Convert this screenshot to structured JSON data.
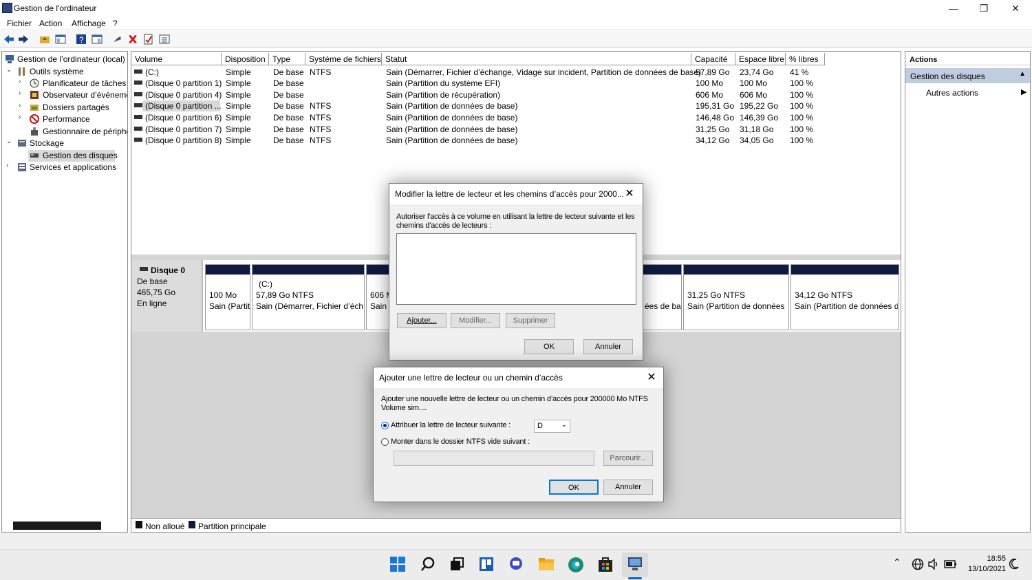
{
  "window": {
    "title": "Gestion de l'ordinateur",
    "minimize": "—",
    "maximize": "❐",
    "close": "✕"
  },
  "menu": [
    "Fichier",
    "Action",
    "Affichage",
    "?"
  ],
  "tree": {
    "root": "Gestion de l’ordinateur (local)",
    "outils": "Outils système",
    "planificateur": "Planificateur de tâches",
    "observateur": "Observateur d’événemen",
    "dossiers": "Dossiers partagés",
    "performance": "Performance",
    "gestionnaire": "Gestionnaire de périphé",
    "stockage": "Stockage",
    "gestion_disques": "Gestion des disques",
    "services": "Services et applications"
  },
  "table": {
    "headers": [
      "Volume",
      "Disposition",
      "Type",
      "Système de fichiers",
      "Statut",
      "Capacité",
      "Espace libre",
      "% libres"
    ],
    "rows": [
      [
        "(C:)",
        "Simple",
        "De base",
        "NTFS",
        "Sain (Démarrer, Fichier d’échange, Vidage sur incident, Partition de données de base)",
        "57,89 Go",
        "23,74 Go",
        "41 %"
      ],
      [
        "(Disque 0 partition 1)",
        "Simple",
        "De base",
        "",
        "Sain (Partition du système EFI)",
        "100 Mo",
        "100 Mo",
        "100 %"
      ],
      [
        "(Disque 0 partition 4)",
        "Simple",
        "De base",
        "",
        "Sain (Partition de récupération)",
        "606 Mo",
        "606 Mo",
        "100 %"
      ],
      [
        "(Disque 0 partition ...",
        "Simple",
        "De base",
        "NTFS",
        "Sain (Partition de données de base)",
        "195,31 Go",
        "195,22 Go",
        "100 %"
      ],
      [
        "(Disque 0 partition 6)",
        "Simple",
        "De base",
        "NTFS",
        "Sain (Partition de données de base)",
        "146,48 Go",
        "146,39 Go",
        "100 %"
      ],
      [
        "(Disque 0 partition 7)",
        "Simple",
        "De base",
        "NTFS",
        "Sain (Partition de données de base)",
        "31,25 Go",
        "31,18 Go",
        "100 %"
      ],
      [
        "(Disque 0 partition 8)",
        "Simple",
        "De base",
        "NTFS",
        "Sain (Partition de données de base)",
        "34,12 Go",
        "34,05 Go",
        "100 %"
      ]
    ]
  },
  "disk": {
    "name": "Disque 0",
    "type": "De base",
    "size": "465,75 Go",
    "state": "En ligne",
    "p1_l1": "100 Mo",
    "p1_l2": "Sain (Partiti",
    "p2_l0": "(C:)",
    "p2_l1": "57,89 Go NTFS",
    "p2_l2": "Sain (Démarrer, Fichier d’écha",
    "p3_l1": "606 M",
    "p3_l2": "Sain",
    "p5_l2": "ées de ba",
    "p6_l1": "31,25 Go NTFS",
    "p6_l2": "Sain (Partition de données c",
    "p7_l1": "34,12 Go NTFS",
    "p7_l2": "Sain (Partition de données d"
  },
  "legend": {
    "unalloc": "Non alloué",
    "primary": "Partition principale"
  },
  "actions": {
    "header": "Actions",
    "section": "Gestion des disques",
    "more": "Autres actions"
  },
  "dialog1": {
    "title": "Modifier la lettre de lecteur et les chemins d’accès pour 2000...",
    "desc1": "Autoriser l'accès à ce volume en utilisant la lettre de lecteur suivante et les",
    "desc2": "chemins d'accès de lecteurs :",
    "add": "Ajouter...",
    "modify": "Modifier...",
    "delete": "Supprimer",
    "ok": "OK",
    "cancel": "Annuler"
  },
  "dialog2": {
    "title": "Ajouter une lettre de lecteur ou un chemin d’accès",
    "desc1": "Ajouter une nouvelle lettre de lecteur ou un chemin d’accès pour 200000 Mo NTFS",
    "desc2": "Volume sim....",
    "opt1": "Attribuer la lettre de lecteur suivante :",
    "letter": "D",
    "opt2": "Monter dans le dossier NTFS vide suivant :",
    "browse": "Parcourir...",
    "ok": "OK",
    "cancel": "Annuler"
  },
  "clock": {
    "time": "18:55",
    "date": "13/10/2021"
  }
}
